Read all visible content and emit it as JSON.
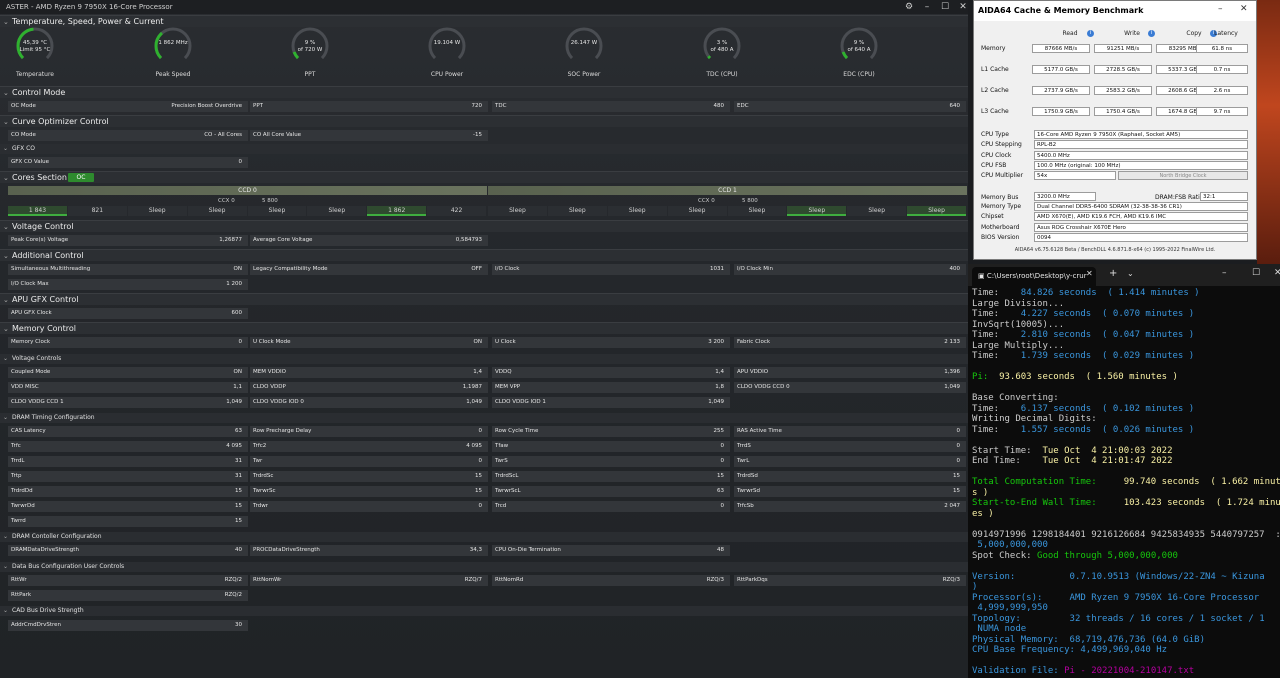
{
  "rm": {
    "title": "ASTER  -  AMD Ryzen 9 7950X 16-Core Processor",
    "sections": {
      "temp": "Temperature, Speed, Power & Current",
      "control": "Control Mode",
      "curve": "Curve Optimizer Control",
      "gfxco": "GFX CO",
      "cores": "Cores Section",
      "voltage": "Voltage Control",
      "additional": "Additional Control",
      "apu": "APU GFX Control",
      "memory": "Memory Control",
      "voltages": "Voltage Controls",
      "dram": "DRAM Timing Configuration",
      "dramctl": "DRAM Contoller Configuration",
      "databus": "Data Bus Configuration User Controls",
      "cad": "CAD Bus Drive Strength"
    },
    "oc_badge": "OC",
    "gauges": [
      {
        "v1": "45,39 °C",
        "v2": "Limit 95 °C",
        "label": "Temperature",
        "frac": 0.48
      },
      {
        "v1": "1 862  MHz",
        "v2": "",
        "label": "Peak Speed",
        "frac": 0.35
      },
      {
        "v1": "9 %",
        "v2": "of 720 W",
        "label": "PPT",
        "frac": 0.09
      },
      {
        "v1": "19.104 W",
        "v2": "",
        "label": "CPU Power",
        "frac": 0.0
      },
      {
        "v1": "26.147 W",
        "v2": "",
        "label": "SOC Power",
        "frac": 0.0
      },
      {
        "v1": "3 %",
        "v2": "of 480 A",
        "label": "TDC (CPU)",
        "frac": 0.03
      },
      {
        "v1": "9 %",
        "v2": "of 640 A",
        "label": "EDC (CPU)",
        "frac": 0.09
      }
    ],
    "control_row": [
      {
        "l": "OC Mode",
        "v": "Precision Boost Overdrive"
      },
      {
        "l": "PPT",
        "v": "720"
      },
      {
        "l": "TDC",
        "v": "480"
      },
      {
        "l": "EDC",
        "v": "640"
      }
    ],
    "curve_row": [
      {
        "l": "CO Mode",
        "v": "CO - All Cores"
      },
      {
        "l": "CO All Core Value",
        "v": "-15"
      }
    ],
    "gfx_row": [
      {
        "l": "GFX CO Value",
        "v": "0"
      }
    ],
    "ccd": [
      {
        "name": "CCD 0",
        "ccx": "CCX 0",
        "freq": "5 800",
        "cores": [
          "1 843",
          "821",
          "Sleep",
          "Sleep",
          "Sleep",
          "Sleep",
          "1 862",
          "422"
        ],
        "active": [
          true,
          false,
          false,
          false,
          false,
          false,
          true,
          false
        ]
      },
      {
        "name": "CCD 1",
        "ccx": "CCX 0",
        "freq": "5 800",
        "cores": [
          "Sleep",
          "Sleep",
          "Sleep",
          "Sleep",
          "Sleep",
          "Sleep",
          "Sleep",
          "Sleep"
        ],
        "active": [
          false,
          false,
          false,
          false,
          false,
          true,
          false,
          true
        ]
      }
    ],
    "voltage_row": [
      {
        "l": "Peak Core(s) Voltage",
        "v": "1,26877"
      },
      {
        "l": "Average Core Voltage",
        "v": "0,584793"
      }
    ],
    "additional_row1": [
      {
        "l": "Simultaneous Multithreading",
        "v": "ON"
      },
      {
        "l": "Legacy Compatibility Mode",
        "v": "OFF"
      },
      {
        "l": "I/O Clock",
        "v": "1031"
      },
      {
        "l": "I/O Clock Min",
        "v": "400"
      }
    ],
    "additional_row2": [
      {
        "l": "I/O Clock Max",
        "v": "1 200"
      }
    ],
    "apu_row": [
      {
        "l": "APU GFX Clock",
        "v": "600"
      }
    ],
    "memory_row": [
      {
        "l": "Memory Clock",
        "v": "0"
      },
      {
        "l": "U Clock Mode",
        "v": "ON"
      },
      {
        "l": "U Clock",
        "v": "3 200"
      },
      {
        "l": "Fabric Clock",
        "v": "2 133"
      }
    ],
    "volt_rows": [
      [
        {
          "l": "Coupled Mode",
          "v": "ON"
        },
        {
          "l": "MEM VDDIO",
          "v": "1,4"
        },
        {
          "l": "VDDQ",
          "v": "1,4"
        },
        {
          "l": "APU VDDIO",
          "v": "1,396"
        }
      ],
      [
        {
          "l": "VDD MISC",
          "v": "1,1"
        },
        {
          "l": "CLDO VDDP",
          "v": "1,1987"
        },
        {
          "l": "MEM VPP",
          "v": "1,8"
        },
        {
          "l": "CLDO VDDG CCD 0",
          "v": "1,049"
        }
      ],
      [
        {
          "l": "CLDO VDDG CCD 1",
          "v": "1,049"
        },
        {
          "l": "CLDO VDDG IOD 0",
          "v": "1,049"
        },
        {
          "l": "CLDO VDDG IOD 1",
          "v": "1,049"
        }
      ]
    ],
    "dram_rows": [
      [
        {
          "l": "CAS Latency",
          "v": "63"
        },
        {
          "l": "Row Precharge Delay",
          "v": "0"
        },
        {
          "l": "Row Cycle Time",
          "v": "255"
        },
        {
          "l": "RAS Active Time",
          "v": "0"
        }
      ],
      [
        {
          "l": "Trfc",
          "v": "4 095"
        },
        {
          "l": "Trfc2",
          "v": "4 095"
        },
        {
          "l": "Tfaw",
          "v": "0"
        },
        {
          "l": "TrrdS",
          "v": "0"
        }
      ],
      [
        {
          "l": "TrrdL",
          "v": "31"
        },
        {
          "l": "Twr",
          "v": "0"
        },
        {
          "l": "TwrS",
          "v": "0"
        },
        {
          "l": "TwrL",
          "v": "0"
        }
      ],
      [
        {
          "l": "Trtp",
          "v": "31"
        },
        {
          "l": "TrdrdSc",
          "v": "15"
        },
        {
          "l": "TrdrdScL",
          "v": "15"
        },
        {
          "l": "TrdrdSd",
          "v": "15"
        }
      ],
      [
        {
          "l": "TrdrdDd",
          "v": "15"
        },
        {
          "l": "TwrwrSc",
          "v": "15"
        },
        {
          "l": "TwrwrScL",
          "v": "63"
        },
        {
          "l": "TwrwrSd",
          "v": "15"
        }
      ],
      [
        {
          "l": "TwrwrDd",
          "v": "15"
        },
        {
          "l": "Trdwr",
          "v": "0"
        },
        {
          "l": "Trcd",
          "v": "0"
        },
        {
          "l": "TrfcSb",
          "v": "2 047"
        }
      ],
      [
        {
          "l": "Twrrd",
          "v": "15"
        }
      ]
    ],
    "dramctl_row": [
      {
        "l": "DRAMDataDriveStrength",
        "v": "40"
      },
      {
        "l": "PROCDataDriveStrength",
        "v": "34,3"
      },
      {
        "l": "CPU On-Die Termination",
        "v": "48"
      }
    ],
    "databus_rows": [
      [
        {
          "l": "RttWr",
          "v": "RZQ/2"
        },
        {
          "l": "RttNomWr",
          "v": "RZQ/7"
        },
        {
          "l": "RttNomRd",
          "v": "RZQ/3"
        },
        {
          "l": "RttParkDqs",
          "v": "RZQ/3"
        }
      ],
      [
        {
          "l": "RttPark",
          "v": "RZQ/2"
        }
      ]
    ],
    "cad_row": [
      {
        "l": "AddrCmdDrvStren",
        "v": "30"
      }
    ]
  },
  "aida": {
    "title": "AIDA64 Cache & Memory Benchmark",
    "heads": {
      "read": "Read",
      "write": "Write",
      "copy": "Copy",
      "latency": "Latency"
    },
    "bench": [
      {
        "l": "Memory",
        "r": "87666 MB/s",
        "w": "91251 MB/s",
        "c": "83295 MB/s",
        "lat": "61.8 ns"
      },
      {
        "l": "L1 Cache",
        "r": "5177.0 GB/s",
        "w": "2728.5 GB/s",
        "c": "5337.3 GB/s",
        "lat": "0.7 ns"
      },
      {
        "l": "L2 Cache",
        "r": "2737.9 GB/s",
        "w": "2583.2 GB/s",
        "c": "2608.6 GB/s",
        "lat": "2.6 ns"
      },
      {
        "l": "L3 Cache",
        "r": "1750.9 GB/s",
        "w": "1750.4 GB/s",
        "c": "1674.8 GB/s",
        "lat": "9.7 ns"
      }
    ],
    "cpu": [
      {
        "l": "CPU Type",
        "v": "16-Core AMD Ryzen 9 7950X  (Raphael, Socket AM5)"
      },
      {
        "l": "CPU Stepping",
        "v": "RPL-B2"
      },
      {
        "l": "CPU Clock",
        "v": "5400.0 MHz"
      },
      {
        "l": "CPU FSB",
        "v": "100.0 MHz  (original: 100 MHz)"
      },
      {
        "l": "CPU Multiplier",
        "v": "54x"
      }
    ],
    "nb_label": "North Bridge Clock",
    "membus": {
      "l": "Memory Bus",
      "v": "3200.0 MHz"
    },
    "ratio": {
      "l": "DRAM:FSB Ratio",
      "v": "32:1"
    },
    "sys": [
      {
        "l": "Memory Type",
        "v": "Dual Channel DDR5-6400 SDRAM  (32-38-38-36 CR1)"
      },
      {
        "l": "Chipset",
        "v": "AMD X670(E), AMD K19.6 FCH, AMD K19.6 IMC"
      },
      {
        "l": "Motherboard",
        "v": "Asus ROG Crosshair X670E Hero"
      },
      {
        "l": "BIOS Version",
        "v": "0094"
      }
    ],
    "footer": "AIDA64 v6.75.6128 Beta / BenchDLL 4.6.871.8-x64  (c) 1995-2022 FinalWire Ltd."
  },
  "term": {
    "tab": "C:\\Users\\root\\Desktop\\y-crur",
    "lines": [
      [
        [
          "w",
          "Time:    "
        ],
        [
          "c",
          "84.826 seconds  ( 1.414 minutes )"
        ]
      ],
      [
        [
          "w",
          "Large Division..."
        ]
      ],
      [
        [
          "w",
          "Time:    "
        ],
        [
          "c",
          "4.227 seconds  ( 0.070 minutes )"
        ]
      ],
      [
        [
          "w",
          "InvSqrt(10005)..."
        ]
      ],
      [
        [
          "w",
          "Time:    "
        ],
        [
          "c",
          "2.810 seconds  ( 0.047 minutes )"
        ]
      ],
      [
        [
          "w",
          "Large Multiply..."
        ]
      ],
      [
        [
          "w",
          "Time:    "
        ],
        [
          "c",
          "1.739 seconds  ( 0.029 minutes )"
        ]
      ],
      [
        [
          "w",
          ""
        ]
      ],
      [
        [
          "g",
          "Pi:  "
        ],
        [
          "y",
          "93.603 seconds  ( 1.560 minutes )"
        ]
      ],
      [
        [
          "w",
          ""
        ]
      ],
      [
        [
          "w",
          "Base Converting:"
        ]
      ],
      [
        [
          "w",
          "Time:    "
        ],
        [
          "c",
          "6.137 seconds  ( 0.102 minutes )"
        ]
      ],
      [
        [
          "w",
          "Writing Decimal Digits:"
        ]
      ],
      [
        [
          "w",
          "Time:    "
        ],
        [
          "c",
          "1.557 seconds  ( 0.026 minutes )"
        ]
      ],
      [
        [
          "w",
          ""
        ]
      ],
      [
        [
          "w",
          "Start Time:  "
        ],
        [
          "y",
          "Tue Oct  4 21:00:03 2022"
        ]
      ],
      [
        [
          "w",
          "End Time:    "
        ],
        [
          "y",
          "Tue Oct  4 21:01:47 2022"
        ]
      ],
      [
        [
          "w",
          ""
        ]
      ],
      [
        [
          "g",
          "Total Computation Time:     "
        ],
        [
          "y",
          "99.740 seconds  ( 1.662 minute"
        ]
      ],
      [
        [
          "y",
          "s )"
        ]
      ],
      [
        [
          "g",
          "Start-to-End Wall Time:     "
        ],
        [
          "y",
          "103.423 seconds  ( 1.724 minut"
        ]
      ],
      [
        [
          "y",
          "es )"
        ]
      ],
      [
        [
          "w",
          ""
        ]
      ],
      [
        [
          "w",
          "0914971996 1298184401 9216126684 9425834935 5440797257  :"
        ]
      ],
      [
        [
          "c",
          " 5,000,000,000"
        ]
      ],
      [
        [
          "w",
          "Spot Check: "
        ],
        [
          "g",
          "Good through 5,000,000,000"
        ]
      ],
      [
        [
          "w",
          ""
        ]
      ],
      [
        [
          "c",
          "Version:          "
        ],
        [
          "c",
          "0.7.10.9513 (Windows/22-ZN4 ~ Kizuna"
        ]
      ],
      [
        [
          "c",
          ")"
        ]
      ],
      [
        [
          "c",
          "Processor(s):     "
        ],
        [
          "c",
          "AMD Ryzen 9 7950X 16-Core Processor"
        ]
      ],
      [
        [
          "c",
          " 4,999,999,950"
        ]
      ],
      [
        [
          "c",
          "Topology:         "
        ],
        [
          "c",
          "32 threads / 16 cores / 1 socket / 1"
        ]
      ],
      [
        [
          "c",
          " NUMA node"
        ]
      ],
      [
        [
          "c",
          "Physical Memory:  "
        ],
        [
          "c",
          "68,719,476,736 (64.0 GiB)"
        ]
      ],
      [
        [
          "c",
          "CPU Base Frequency: "
        ],
        [
          "c",
          "4,499,969,040 Hz"
        ]
      ],
      [
        [
          "w",
          ""
        ]
      ],
      [
        [
          "c",
          "Validation File: "
        ],
        [
          "m",
          "Pi - 20221004-210147.txt"
        ]
      ]
    ]
  }
}
